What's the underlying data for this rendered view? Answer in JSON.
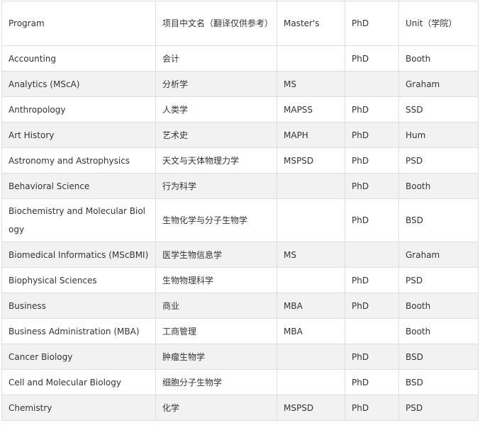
{
  "table": {
    "headers": [
      "Program",
      "项目中文名（翻译仅供参考）",
      "Master's",
      "PhD",
      "Unit（学院）"
    ],
    "rows": [
      [
        "Accounting",
        "会计",
        "",
        "PhD",
        "Booth"
      ],
      [
        "Analytics (MScA)",
        "分析学",
        "MS",
        "",
        "Graham"
      ],
      [
        "Anthropology",
        "人类学",
        "MAPSS",
        "PhD",
        "SSD"
      ],
      [
        "Art History",
        "艺术史",
        "MAPH",
        "PhD",
        "Hum"
      ],
      [
        "Astronomy and Astrophysics",
        "天文与天体物理力学",
        "MSPSD",
        "PhD",
        "PSD"
      ],
      [
        "Behavioral Science",
        "行为科学",
        "",
        "PhD",
        "Booth"
      ],
      [
        "Biochemistry and Molecular Biology",
        "生物化学与分子生物学",
        "",
        "PhD",
        "BSD"
      ],
      [
        "Biomedical Informatics (MScBMI)",
        "医学生物信息学",
        "MS",
        "",
        "Graham"
      ],
      [
        "Biophysical Sciences",
        "生物物理科学",
        "",
        "PhD",
        "PSD"
      ],
      [
        "Business",
        "商业",
        "MBA",
        "PhD",
        "Booth"
      ],
      [
        "Business Administration (MBA)",
        "工商管理",
        "MBA",
        "",
        "Booth"
      ],
      [
        "Cancer Biology",
        "肿瘤生物学",
        "",
        "PhD",
        "BSD"
      ],
      [
        "Cell and Molecular Biology",
        "细胞分子生物学",
        "",
        "PhD",
        "BSD"
      ],
      [
        "Chemistry",
        "化学",
        "MSPSD",
        "PhD",
        "PSD"
      ]
    ]
  }
}
